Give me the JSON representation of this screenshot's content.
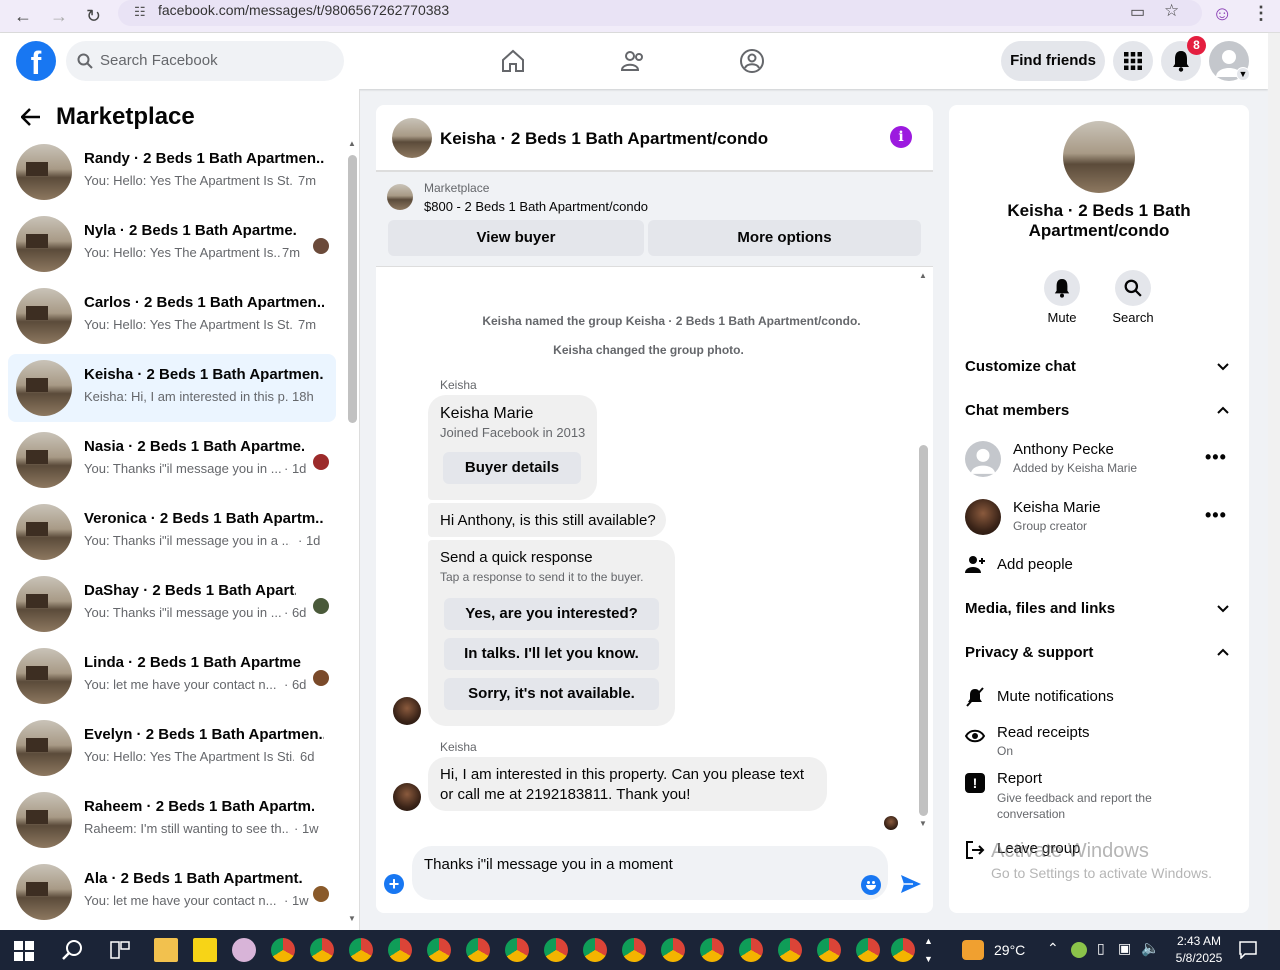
{
  "browser": {
    "url": "facebook.com/messages/t/9806567262770383"
  },
  "header": {
    "logo": "f",
    "search_placeholder": "Search Facebook",
    "find_friends": "Find friends",
    "notification_count": "8"
  },
  "left": {
    "title": "Marketplace",
    "conversations": [
      {
        "name": "Randy · 2 Beds 1 Bath Apartmen...",
        "preview": "You: Hello: Yes The Apartment Is St...",
        "time": "7m"
      },
      {
        "name": "Nyla · 2 Beds 1 Bath Apartme...",
        "preview": "You: Hello: Yes The Apartment Is...",
        "time": "7m"
      },
      {
        "name": "Carlos · 2 Beds 1 Bath Apartmen...",
        "preview": "You: Hello: Yes The Apartment Is St...",
        "time": "7m"
      },
      {
        "name": "Keisha · 2 Beds 1 Bath Apartmen...",
        "preview": "Keisha: Hi, I am interested in this p...",
        "time": "18h"
      },
      {
        "name": "Nasia · 2 Beds 1 Bath Apartme...",
        "preview": "You: Thanks i\"il message you in ...",
        "time": "· 1d"
      },
      {
        "name": "Veronica · 2 Beds 1 Bath Apartm...",
        "preview": "You: Thanks i\"il message you in a ...",
        "time": "· 1d"
      },
      {
        "name": "DaShay · 2 Beds 1 Bath Apart...",
        "preview": "You: Thanks i\"il message you in ...",
        "time": "· 6d"
      },
      {
        "name": "Linda · 2 Beds 1 Bath Apartme...",
        "preview": "You: let me have your contact n...",
        "time": "· 6d"
      },
      {
        "name": "Evelyn · 2 Beds 1 Bath Apartmen...",
        "preview": "You: Hello: Yes The Apartment Is Sti...",
        "time": "6d"
      },
      {
        "name": "Raheem · 2 Beds 1 Bath Apartm...",
        "preview": "Raheem: I'm still wanting to see th...",
        "time": "· 1w"
      },
      {
        "name": "Ala · 2 Beds 1 Bath Apartment...",
        "preview": "You: let me have your contact n...",
        "time": "· 1w"
      }
    ]
  },
  "chat": {
    "title": "Keisha · 2 Beds 1 Bath Apartment/condo",
    "listing_label": "Marketplace",
    "listing_price": "$800 - 2 Beds 1 Bath Apartment/condo",
    "view_buyer": "View buyer",
    "more_options": "More options",
    "system_msg_1": "Keisha named the group Keisha · 2 Beds 1 Bath Apartment/condo.",
    "system_msg_2": "Keisha changed the group photo.",
    "sender_1": "Keisha",
    "card_name": "Keisha Marie",
    "card_joined": "Joined Facebook in 2013",
    "buyer_details": "Buyer details",
    "msg_available": "Hi Anthony, is this still available?",
    "quick_title": "Send a quick response",
    "quick_sub": "Tap a response to send it to the buyer.",
    "quick_1": "Yes, are you interested?",
    "quick_2": "In talks. I'll let you know.",
    "quick_3": "Sorry, it's not available.",
    "sender_2": "Keisha",
    "msg_interest": "Hi, I am interested in this property. Can you please text or call me at 2192183811. Thank you!",
    "composer_text": "Thanks i\"il message you in a moment"
  },
  "right": {
    "title": "Keisha · 2 Beds 1 Bath Apartment/condo",
    "mute": "Mute",
    "search": "Search",
    "customize_chat": "Customize chat",
    "chat_members": "Chat members",
    "member_1_name": "Anthony Pecke",
    "member_1_sub": "Added by Keisha Marie",
    "member_2_name": "Keisha Marie",
    "member_2_sub": "Group creator",
    "add_people": "Add people",
    "media": "Media, files and links",
    "privacy": "Privacy & support",
    "mute_notifications": "Mute notifications",
    "read_receipts": "Read receipts",
    "read_receipts_state": "On",
    "report": "Report",
    "report_sub": "Give feedback and report the conversation",
    "leave_group": "Leave group"
  },
  "watermark": {
    "line1": "Activate Windows",
    "line2": "Go to Settings to activate Windows."
  },
  "taskbar": {
    "temp": "29°C",
    "time": "2:43 AM",
    "date": "5/8/2025"
  },
  "colors": {
    "fb_blue": "#1877f2",
    "purple_info": "#9c1adf",
    "selected_row": "#ebf5ff"
  }
}
